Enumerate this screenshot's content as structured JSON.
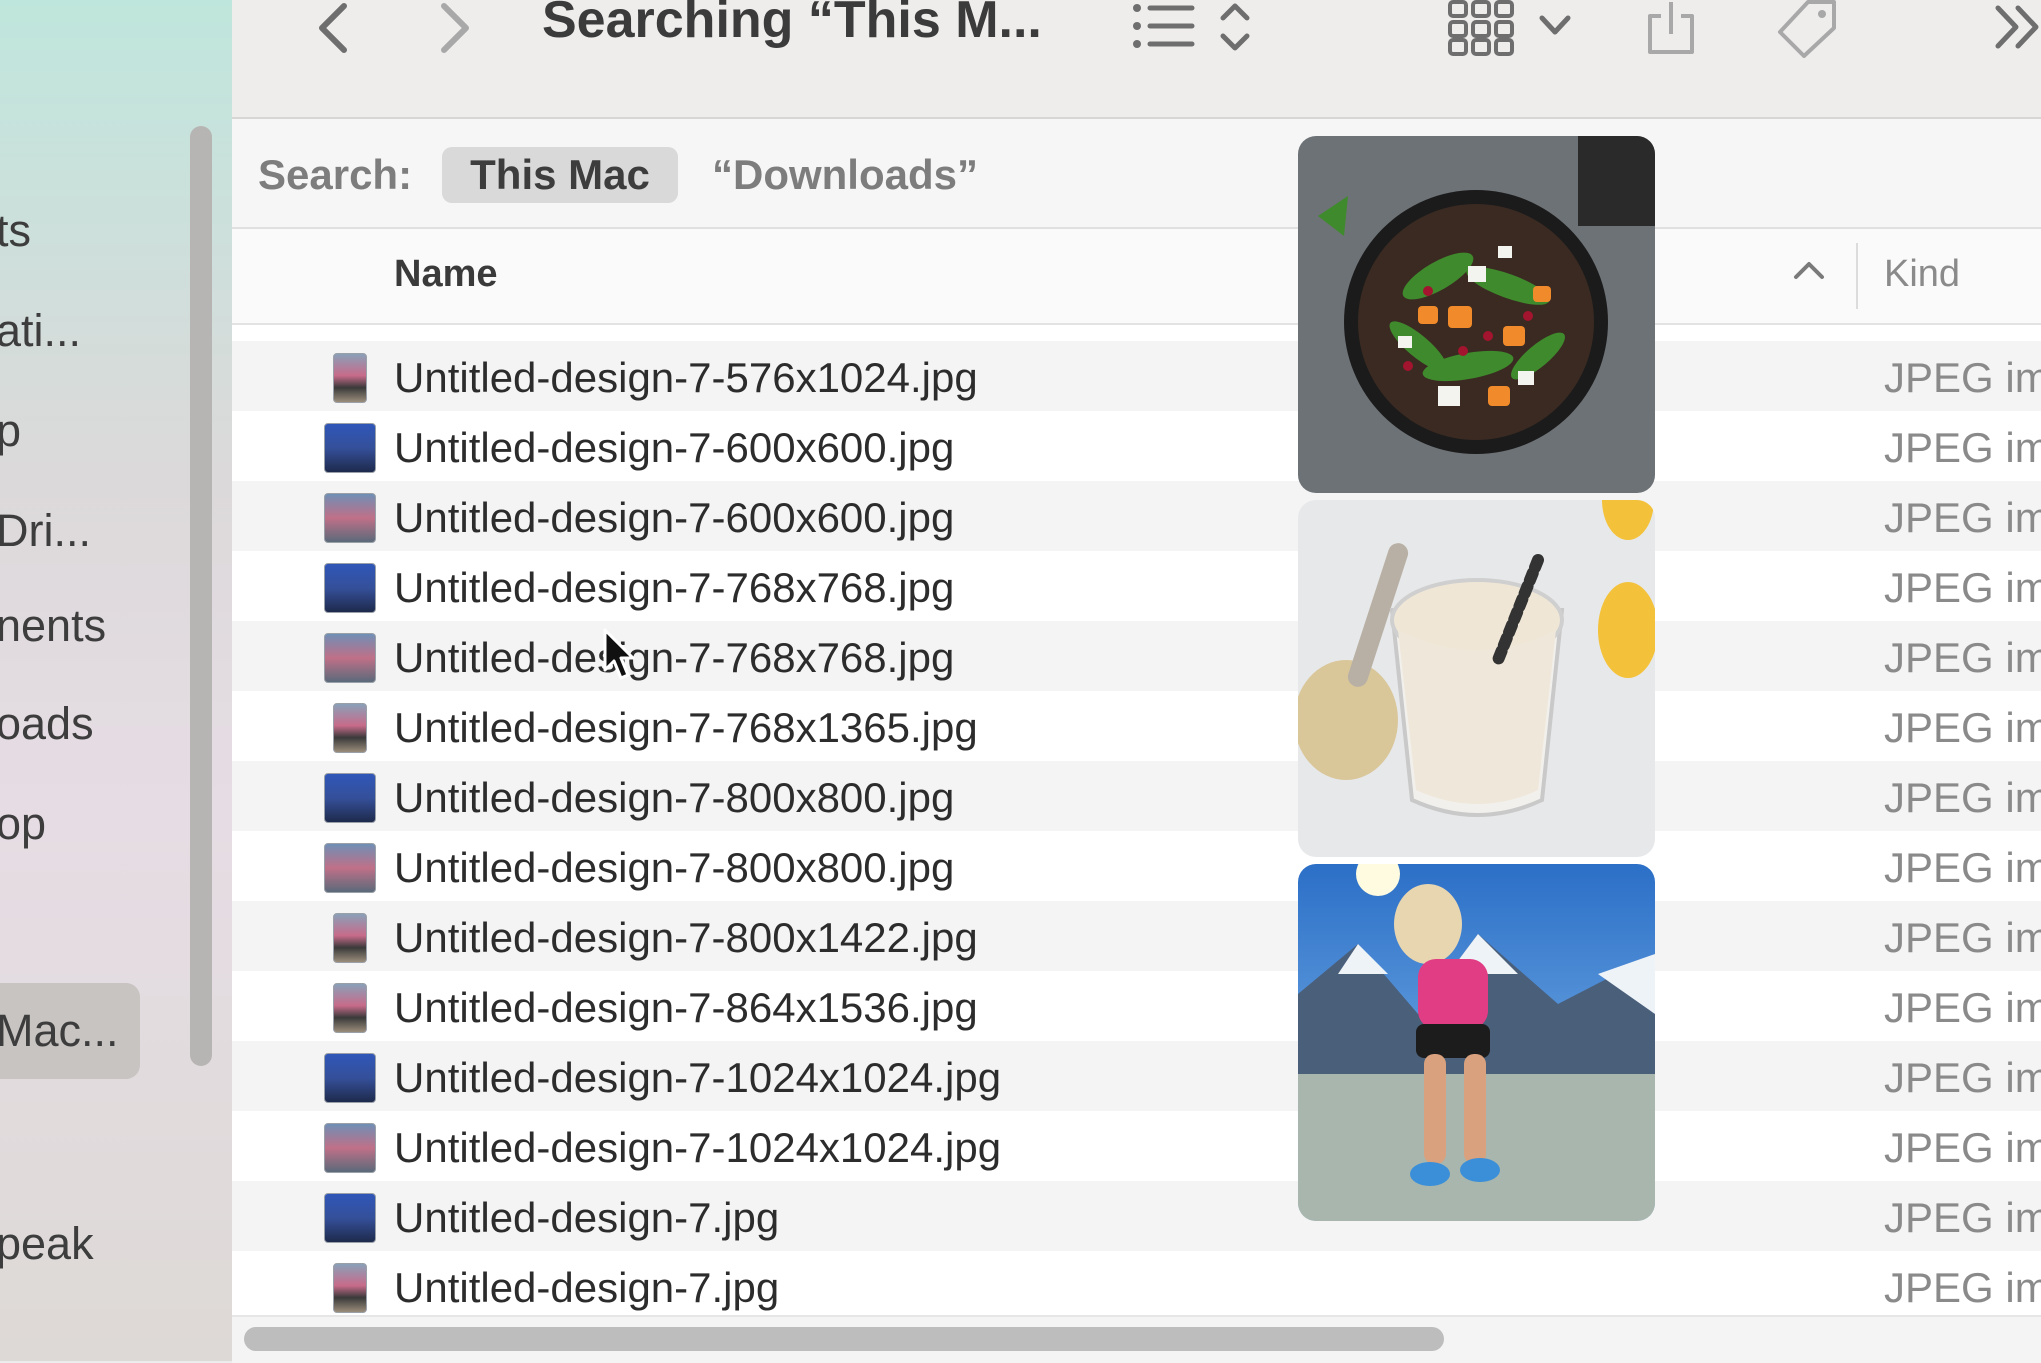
{
  "window": {
    "title": "Searching “This M...",
    "toolbar_icons": [
      "back-chevron-icon",
      "forward-chevron-icon",
      "list-view-icon",
      "sort-arrows-icon",
      "grid-view-icon",
      "chevron-down-icon",
      "share-icon",
      "tag-icon",
      "more-chevrons-icon"
    ]
  },
  "sidebar": {
    "items": [
      {
        "label": "ts"
      },
      {
        "label": "ati..."
      },
      {
        "label": "p"
      },
      {
        "label": " Dri..."
      },
      {
        "label": "nents"
      },
      {
        "label": "oads"
      },
      {
        "label": "op"
      },
      {
        "label": "Mac..."
      },
      {
        "label": "peak"
      }
    ],
    "selected": "Mac..."
  },
  "search": {
    "label": "Search:",
    "scope_selected": "This Mac",
    "scope_other": "“Downloads”"
  },
  "columns": {
    "name": "Name",
    "kind": "Kind"
  },
  "files": [
    {
      "name": "Untitled-design-7-576x1024.jpg",
      "kind": "JPEG im",
      "thumb": "portrait"
    },
    {
      "name": "Untitled-design-7-600x600.jpg",
      "kind": "JPEG im",
      "thumb": "square-blue"
    },
    {
      "name": "Untitled-design-7-600x600.jpg",
      "kind": "JPEG im",
      "thumb": "square-light"
    },
    {
      "name": "Untitled-design-7-768x768.jpg",
      "kind": "JPEG im",
      "thumb": "square-blue"
    },
    {
      "name": "Untitled-design-7-768x768.jpg",
      "kind": "JPEG im",
      "thumb": "square-light"
    },
    {
      "name": "Untitled-design-7-768x1365.jpg",
      "kind": "JPEG im",
      "thumb": "portrait"
    },
    {
      "name": "Untitled-design-7-800x800.jpg",
      "kind": "JPEG im",
      "thumb": "square-blue"
    },
    {
      "name": "Untitled-design-7-800x800.jpg",
      "kind": "JPEG im",
      "thumb": "square-light"
    },
    {
      "name": "Untitled-design-7-800x1422.jpg",
      "kind": "JPEG im",
      "thumb": "portrait"
    },
    {
      "name": "Untitled-design-7-864x1536.jpg",
      "kind": "JPEG im",
      "thumb": "portrait"
    },
    {
      "name": "Untitled-design-7-1024x1024.jpg",
      "kind": "JPEG im",
      "thumb": "square-blue"
    },
    {
      "name": "Untitled-design-7-1024x1024.jpg",
      "kind": "JPEG im",
      "thumb": "square-light"
    },
    {
      "name": "Untitled-design-7.jpg",
      "kind": "JPEG im",
      "thumb": "square-blue"
    },
    {
      "name": "Untitled-design-7.jpg",
      "kind": "JPEG im",
      "thumb": "portrait"
    }
  ],
  "previews": [
    {
      "subject": "salad-bowl-image"
    },
    {
      "subject": "smoothie-glass-image"
    },
    {
      "subject": "runner-mountains-image"
    }
  ],
  "colors": {
    "sidebar_top": "#bfe6dc",
    "selection": "#c8c4c2",
    "row_alt": "#f4f4f4",
    "text": "#2c2c2c",
    "muted": "#8a8a8a"
  }
}
